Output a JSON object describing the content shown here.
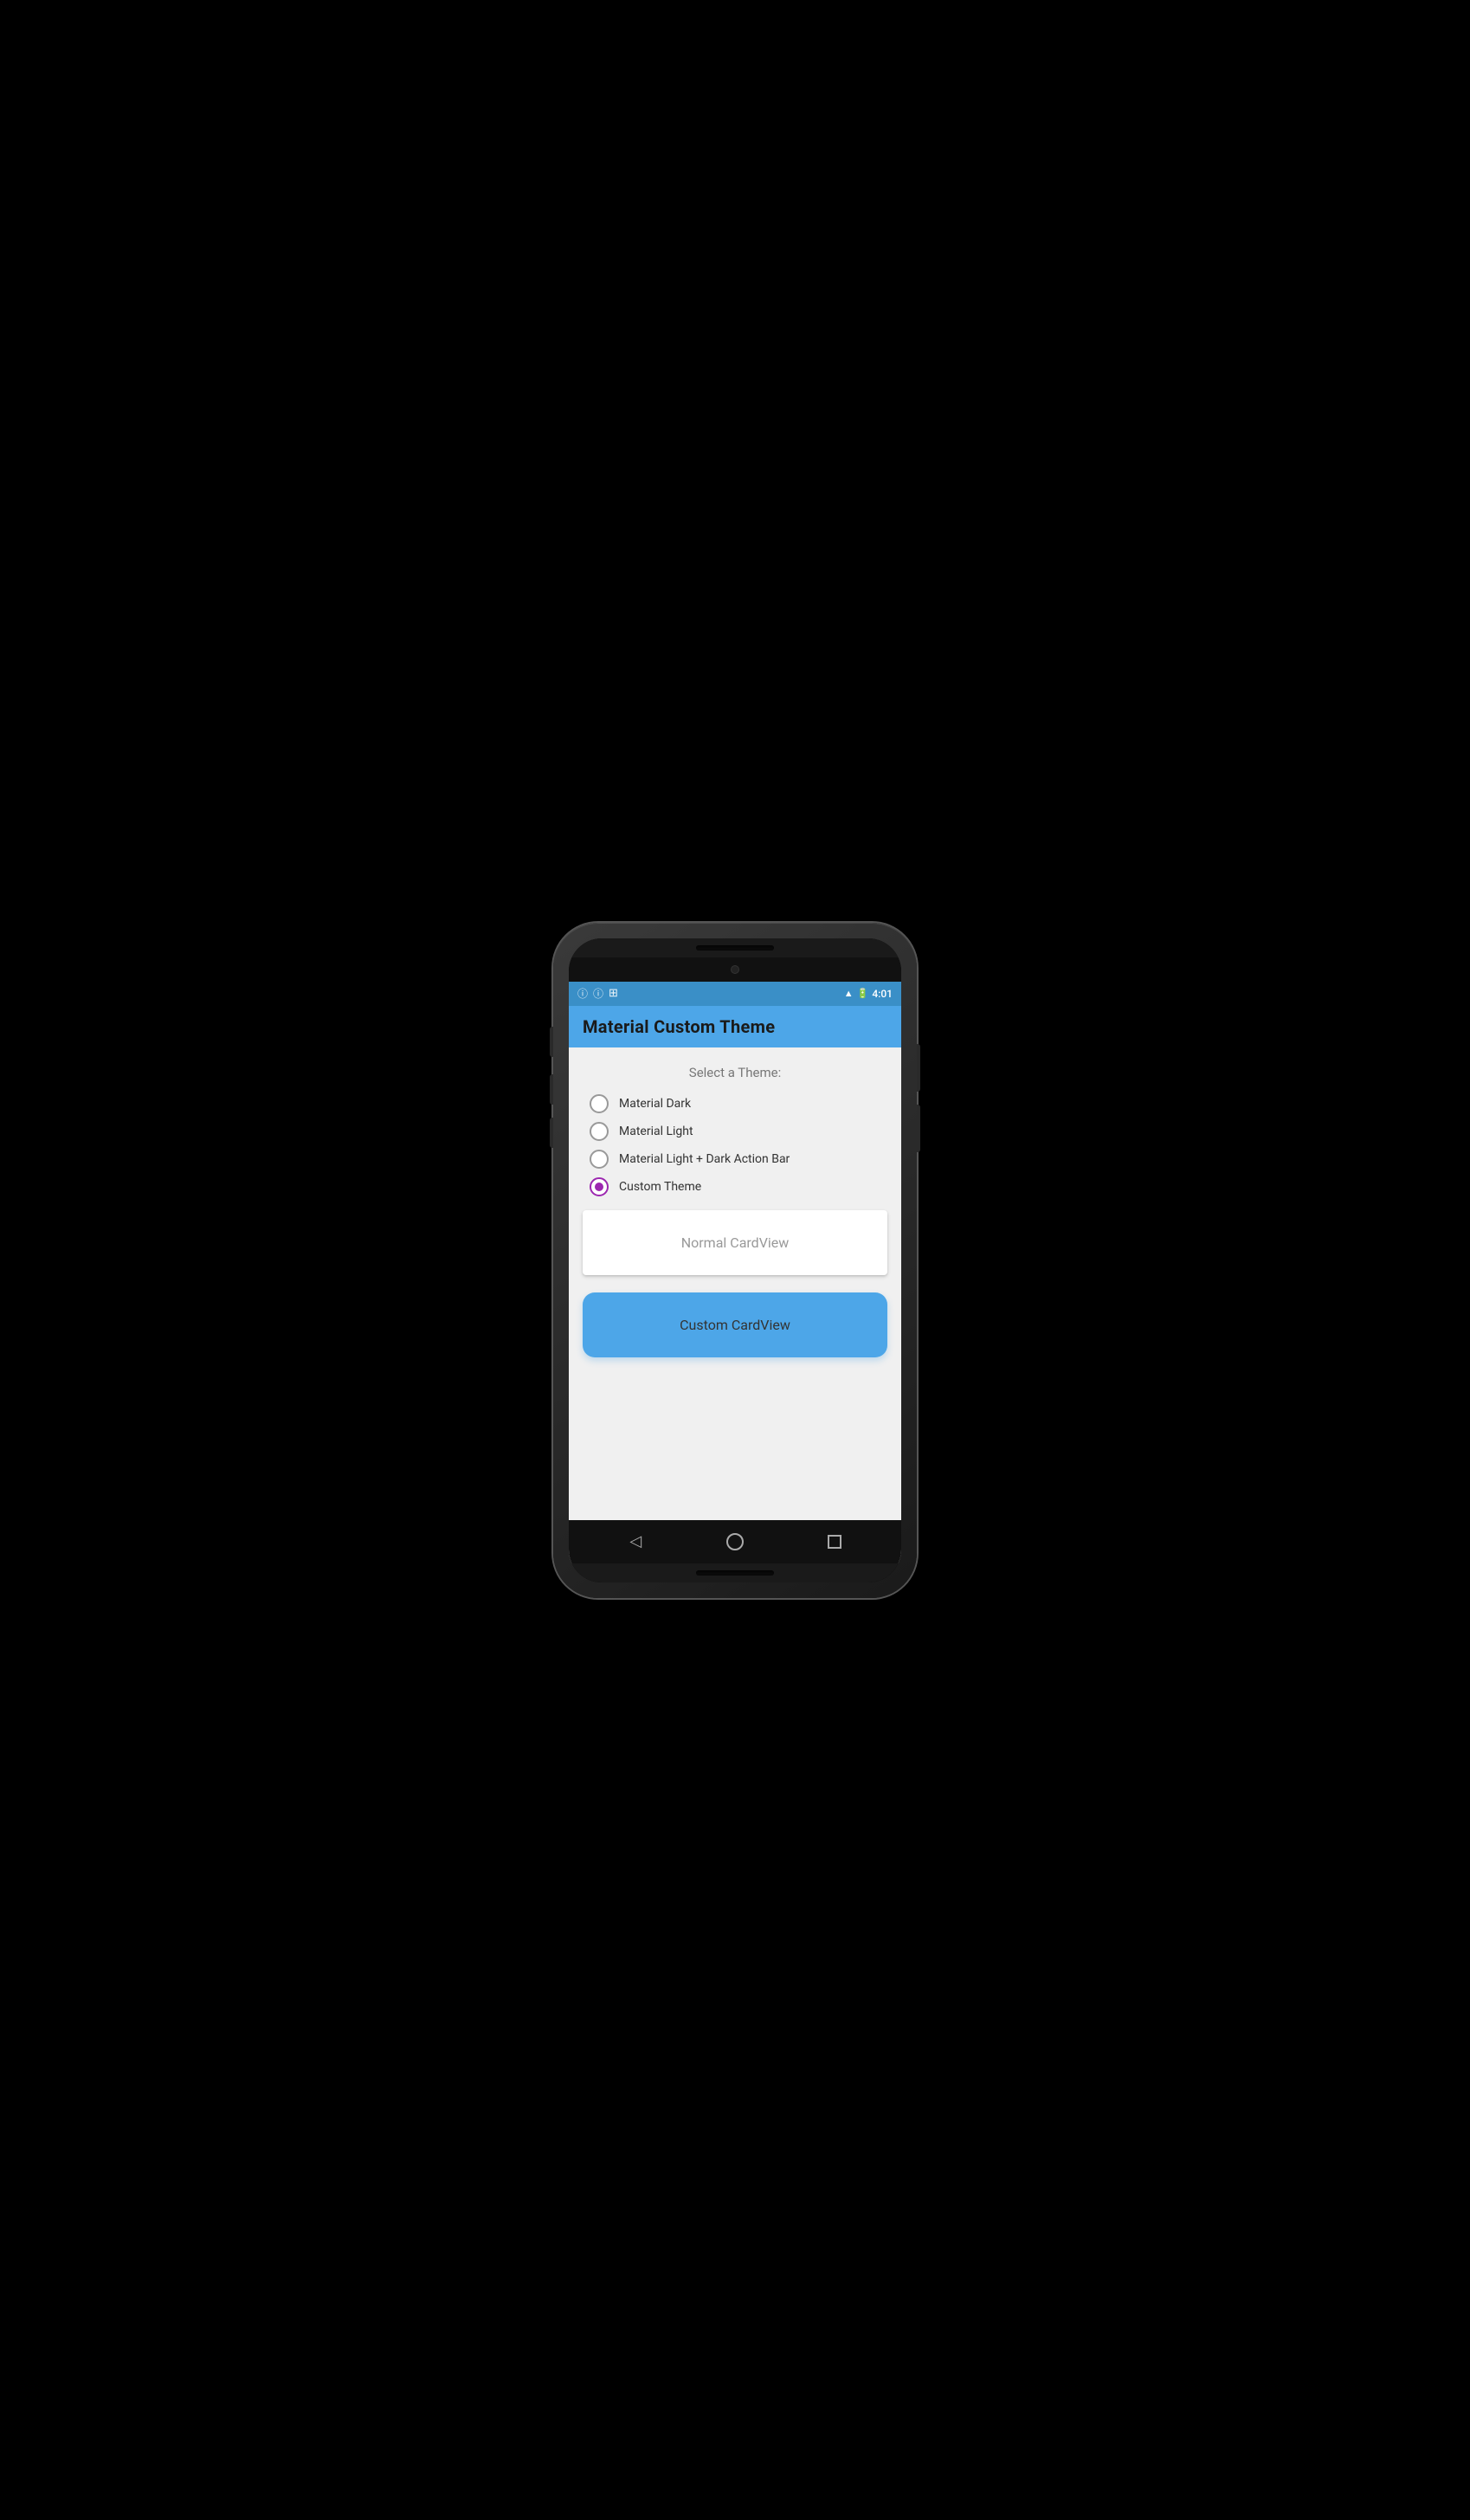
{
  "statusBar": {
    "time": "4:01",
    "icons": [
      "ⓘ",
      "ⓘ",
      "⊞"
    ]
  },
  "appBar": {
    "title": "Material Custom Theme"
  },
  "content": {
    "selectLabel": "Select a Theme:",
    "radioOptions": [
      {
        "id": "material-dark",
        "label": "Material Dark",
        "selected": false
      },
      {
        "id": "material-light",
        "label": "Material Light",
        "selected": false
      },
      {
        "id": "material-light-dark",
        "label": "Material Light + Dark Action Bar",
        "selected": false
      },
      {
        "id": "custom-theme",
        "label": "Custom Theme",
        "selected": true
      }
    ],
    "normalCard": {
      "label": "Normal CardView"
    },
    "customCard": {
      "label": "Custom CardView"
    }
  },
  "nav": {
    "back": "◁",
    "home": "○",
    "recent": "□"
  }
}
